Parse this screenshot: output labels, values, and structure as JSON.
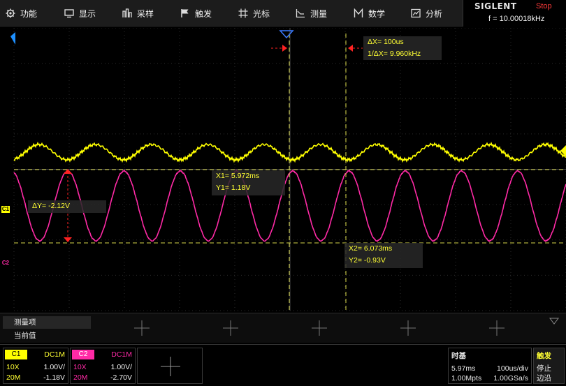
{
  "menu": [
    {
      "label": "功能",
      "icon": "gear-icon"
    },
    {
      "label": "显示",
      "icon": "display-icon"
    },
    {
      "label": "采样",
      "icon": "acquire-icon"
    },
    {
      "label": "触发",
      "icon": "trigger-flag-icon"
    },
    {
      "label": "光标",
      "icon": "cursor-icon"
    },
    {
      "label": "测量",
      "icon": "measure-icon"
    },
    {
      "label": "数学",
      "icon": "math-icon"
    },
    {
      "label": "分析",
      "icon": "analysis-icon"
    }
  ],
  "brand": {
    "name": "SIGLENT",
    "run_state": "Stop",
    "frequency": "f = 10.00018kHz"
  },
  "cursors": {
    "delta_x": "ΔX= 100us",
    "inv_delta_x": "1/ΔX= 9.960kHz",
    "x1": "X1= 5.972ms",
    "y1": "Y1= 1.18V",
    "delta_y": "ΔY= -2.12V",
    "x2": "X2= 6.073ms",
    "y2": "Y2= -0.93V"
  },
  "channel_markers": {
    "c1": "C1",
    "c2": "C2"
  },
  "measure": {
    "title": "测量项",
    "subtitle": "当前值"
  },
  "channels": [
    {
      "name": "C1",
      "coupling": "DC1M",
      "probe": "10X",
      "scale": "1.00V/",
      "bandwidth": "20M",
      "offset": "-1.18V",
      "color": "#ffff00"
    },
    {
      "name": "C2",
      "coupling": "DC1M",
      "probe": "10X",
      "scale": "1.00V/",
      "bandwidth": "20M",
      "offset": "-2.70V",
      "color": "#ff1493"
    }
  ],
  "timebase": {
    "title": "时基",
    "delay": "5.97ms",
    "scale": "100us/div",
    "memory": "1.00Mpts",
    "sample_rate": "1.00GSa/s"
  },
  "trigger": {
    "title": "触发",
    "state": "停止",
    "type": "边沿"
  },
  "colors": {
    "ch1": "#ffff00",
    "ch2": "#ff2aa6",
    "cursor": "#e8e85a",
    "marker_red": "#ff2222",
    "accent_blue": "#1e90ff"
  }
}
